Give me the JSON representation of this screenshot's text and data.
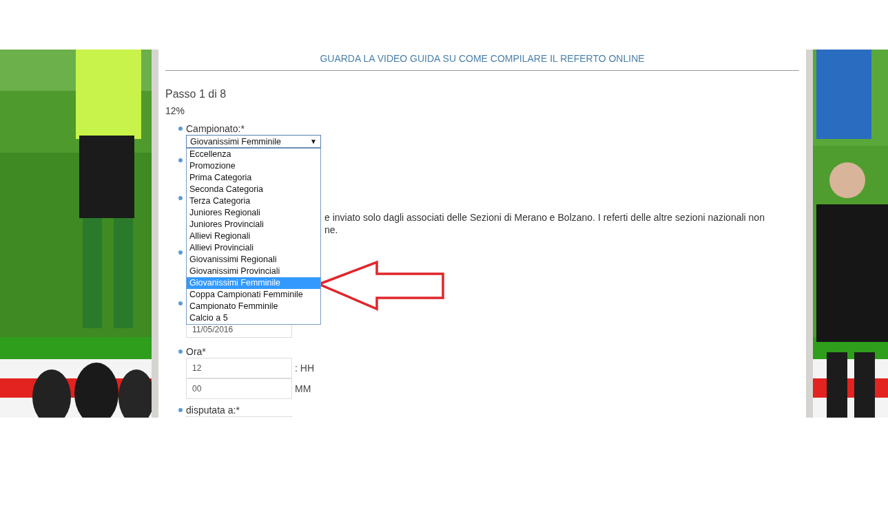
{
  "header_link": "GUARDA LA VIDEO GUIDA SU COME COMPILARE IL REFERTO ONLINE",
  "step": "Passo 1 di 8",
  "progress": "12%",
  "fields": [
    {
      "kind": "select",
      "label": "Campionato:*",
      "value": "Giovanissimi Femminile",
      "caret": "▼",
      "expanded": true,
      "options": [
        {
          "label": "Eccellenza",
          "selected": false
        },
        {
          "label": "Promozione",
          "selected": false
        },
        {
          "label": "Prima Categoria",
          "selected": false
        },
        {
          "label": "Seconda Categoria",
          "selected": false
        },
        {
          "label": "Terza Categoria",
          "selected": false
        },
        {
          "label": "Juniores Regionali",
          "selected": false
        },
        {
          "label": "Juniores Provinciali",
          "selected": false
        },
        {
          "label": "Allievi Regionali",
          "selected": false
        },
        {
          "label": "Allievi Provinciali",
          "selected": false
        },
        {
          "label": "Giovanissimi Regionali",
          "selected": false
        },
        {
          "label": "Giovanissimi Provinciali",
          "selected": false
        },
        {
          "label": "Giovanissimi Femminile",
          "selected": true
        },
        {
          "label": "Coppa Campionati Femminile",
          "selected": false
        },
        {
          "label": "Campionato Femminile",
          "selected": false
        },
        {
          "label": "Calcio a 5",
          "selected": false
        }
      ]
    },
    {
      "kind": "covered"
    },
    {
      "kind": "note",
      "lines": [
        "e inviato solo dagli associati delle Sezioni di Merano e Bolzano. I referti delle altre sezioni nazionali non",
        "ne."
      ]
    },
    {
      "kind": "covered"
    },
    {
      "kind": "date",
      "value": "11/05/2016"
    },
    {
      "kind": "time",
      "label": "Ora*",
      "hours": "12",
      "hours_unit": ": HH",
      "minutes": "00",
      "minutes_unit": "MM"
    },
    {
      "kind": "text",
      "label": "disputata a:*"
    }
  ]
}
